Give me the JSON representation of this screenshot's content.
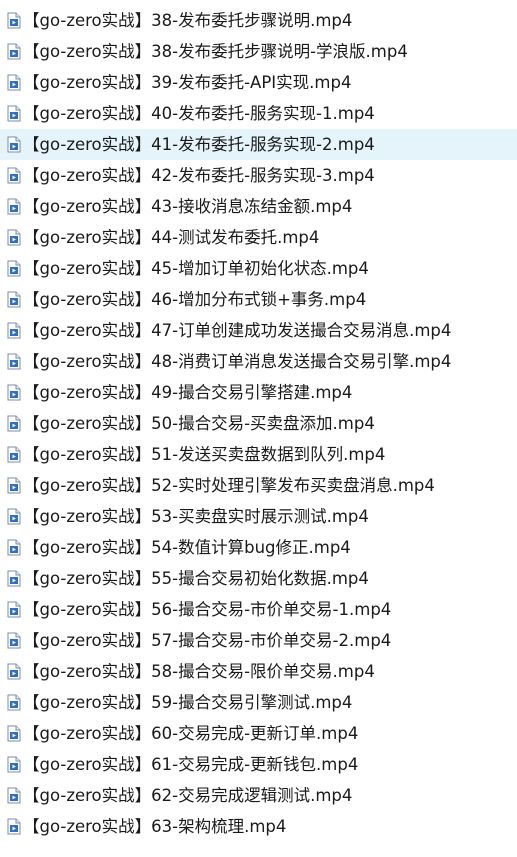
{
  "files": [
    {
      "name": "【go-zero实战】38-发布委托步骤说明.mp4",
      "icon": "video-file-icon"
    },
    {
      "name": "【go-zero实战】38-发布委托步骤说明-学浪版.mp4",
      "icon": "video-file-icon"
    },
    {
      "name": "【go-zero实战】39-发布委托-API实现.mp4",
      "icon": "video-file-icon"
    },
    {
      "name": "【go-zero实战】40-发布委托-服务实现-1.mp4",
      "icon": "video-file-icon"
    },
    {
      "name": "【go-zero实战】41-发布委托-服务实现-2.mp4",
      "icon": "video-file-icon",
      "selected": true
    },
    {
      "name": "【go-zero实战】42-发布委托-服务实现-3.mp4",
      "icon": "video-file-icon"
    },
    {
      "name": "【go-zero实战】43-接收消息冻结金额.mp4",
      "icon": "video-file-icon"
    },
    {
      "name": "【go-zero实战】44-测试发布委托.mp4",
      "icon": "video-file-icon"
    },
    {
      "name": "【go-zero实战】45-增加订单初始化状态.mp4",
      "icon": "video-file-icon"
    },
    {
      "name": "【go-zero实战】46-增加分布式锁+事务.mp4",
      "icon": "video-file-icon"
    },
    {
      "name": "【go-zero实战】47-订单创建成功发送撮合交易消息.mp4",
      "icon": "video-file-icon"
    },
    {
      "name": "【go-zero实战】48-消费订单消息发送撮合交易引擎.mp4",
      "icon": "video-file-icon"
    },
    {
      "name": "【go-zero实战】49-撮合交易引擎搭建.mp4",
      "icon": "video-file-icon"
    },
    {
      "name": "【go-zero实战】50-撮合交易-买卖盘添加.mp4",
      "icon": "video-file-icon"
    },
    {
      "name": "【go-zero实战】51-发送买卖盘数据到队列.mp4",
      "icon": "video-file-icon"
    },
    {
      "name": "【go-zero实战】52-实时处理引擎发布买卖盘消息.mp4",
      "icon": "video-file-icon"
    },
    {
      "name": "【go-zero实战】53-买卖盘实时展示测试.mp4",
      "icon": "video-file-icon"
    },
    {
      "name": "【go-zero实战】54-数值计算bug修正.mp4",
      "icon": "video-file-icon"
    },
    {
      "name": "【go-zero实战】55-撮合交易初始化数据.mp4",
      "icon": "video-file-icon"
    },
    {
      "name": "【go-zero实战】56-撮合交易-市价单交易-1.mp4",
      "icon": "video-file-icon"
    },
    {
      "name": "【go-zero实战】57-撮合交易-市价单交易-2.mp4",
      "icon": "video-file-icon"
    },
    {
      "name": "【go-zero实战】58-撮合交易-限价单交易.mp4",
      "icon": "video-file-icon"
    },
    {
      "name": "【go-zero实战】59-撮合交易引擎测试.mp4",
      "icon": "video-file-icon"
    },
    {
      "name": "【go-zero实战】60-交易完成-更新订单.mp4",
      "icon": "video-file-icon"
    },
    {
      "name": "【go-zero实战】61-交易完成-更新钱包.mp4",
      "icon": "video-file-icon"
    },
    {
      "name": "【go-zero实战】62-交易完成逻辑测试.mp4",
      "icon": "video-file-icon"
    },
    {
      "name": "【go-zero实战】63-架构梳理.mp4",
      "icon": "video-file-icon"
    }
  ],
  "colors": {
    "selected_row": "#e5f3fb",
    "icon_blue": "#2f6fc1",
    "text": "#1a1a1a"
  }
}
